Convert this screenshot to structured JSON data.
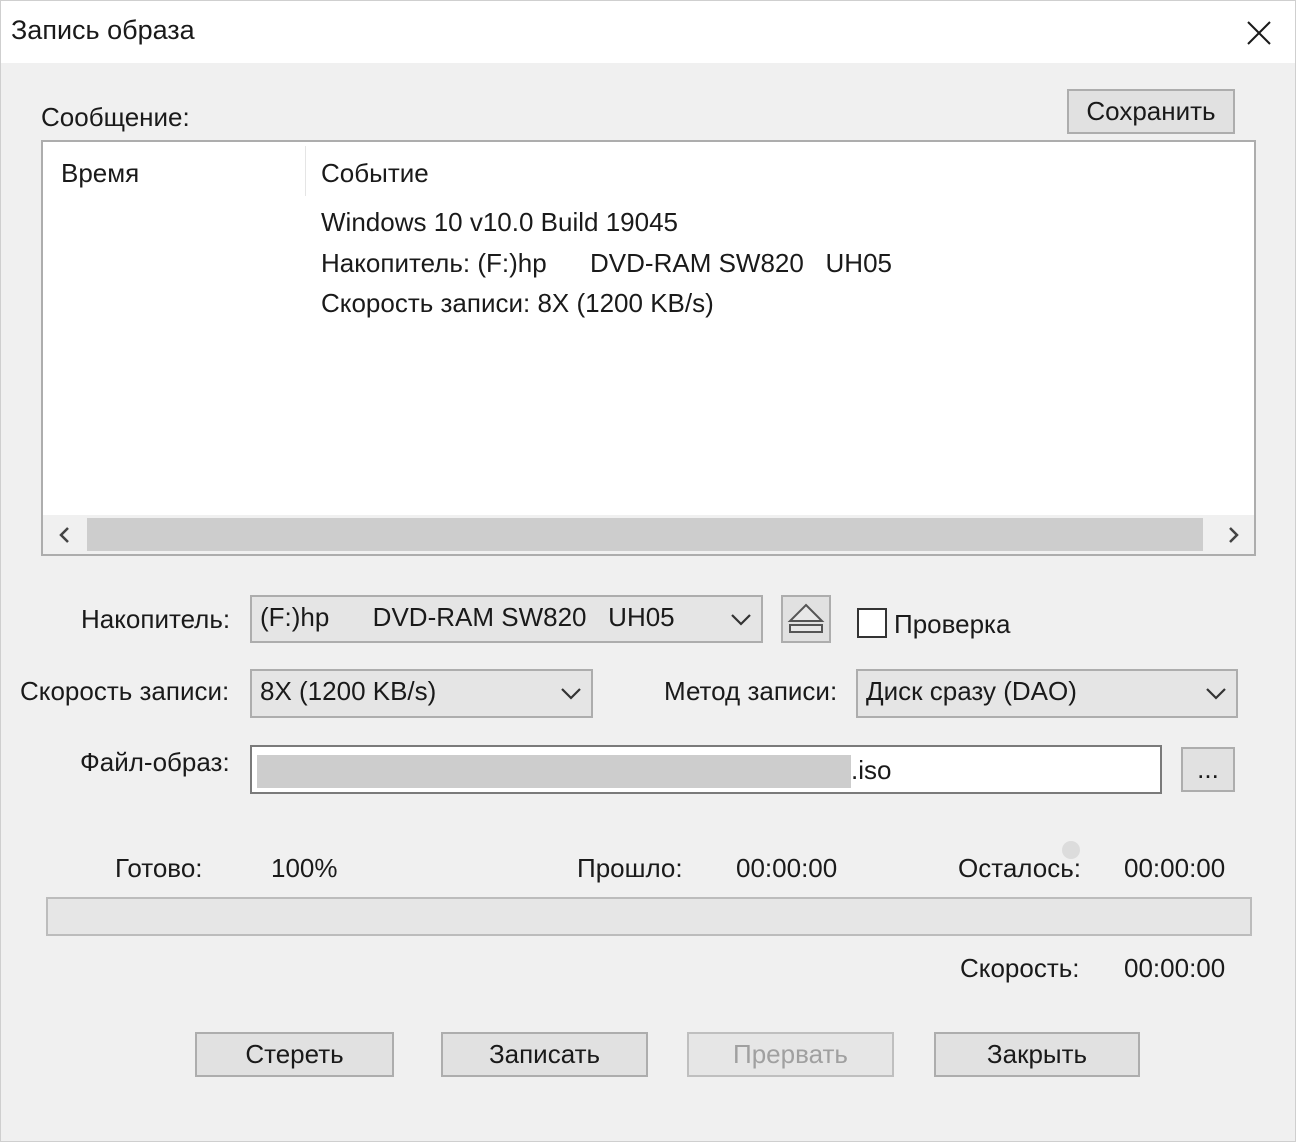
{
  "window": {
    "title": "Запись образа"
  },
  "log": {
    "label": "Сообщение:",
    "save_button": "Сохранить",
    "columns": {
      "time": "Время",
      "event": "Событие"
    },
    "events": [
      "Windows 10 v10.0 Build 19045",
      "Накопитель: (F:)hp      DVD-RAM SW820   UH05",
      "Скорость записи: 8X (1200 KB/s)"
    ]
  },
  "settings": {
    "drive_label": "Накопитель:",
    "drive_value": "(F:)hp      DVD-RAM SW820   UH05",
    "verify_label": "Проверка",
    "verify_checked": false,
    "speed_label": "Скорость записи:",
    "speed_value": "8X (1200 KB/s)",
    "method_label": "Метод записи:",
    "method_value": "Диск сразу (DAO)",
    "image_label": "Файл-образ:",
    "image_value_visible": ".iso",
    "browse_button": "..."
  },
  "status": {
    "done_label": "Готово:",
    "done_value": "100%",
    "elapsed_label": "Прошло:",
    "elapsed_value": "00:00:00",
    "remaining_label": "Осталось:",
    "remaining_value": "00:00:00",
    "speed_label": "Скорость:",
    "speed_value": "00:00:00",
    "progress_fraction": 1.0
  },
  "buttons": {
    "erase": "Стереть",
    "write": "Записать",
    "abort": "Прервать",
    "close": "Закрыть"
  },
  "colors": {
    "background": "#f0f0f0",
    "button_face": "#e1e1e1",
    "disabled_text": "#a0a0a0"
  }
}
